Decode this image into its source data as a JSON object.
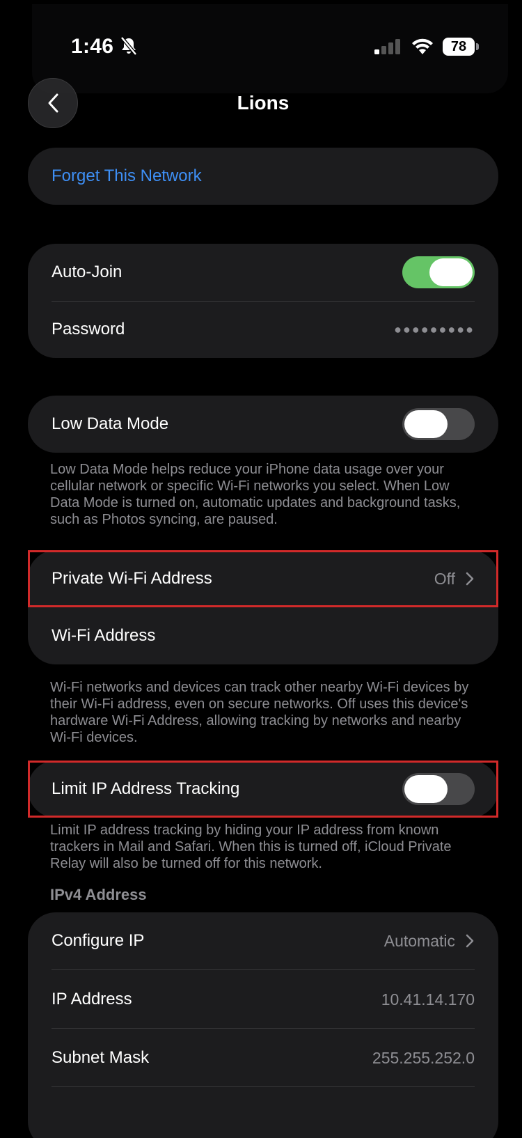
{
  "status_bar": {
    "time": "1:46",
    "battery": "78"
  },
  "nav": {
    "title": "Lions"
  },
  "forget_group": {
    "forget_label": "Forget This Network"
  },
  "join_group": {
    "auto_join_label": "Auto-Join",
    "auto_join_on": true,
    "password_label": "Password",
    "password_mask": "●●●●●●●●●"
  },
  "low_data": {
    "label": "Low Data Mode",
    "on": false,
    "footnote": "Low Data Mode helps reduce your iPhone data usage over your cellular network or specific Wi-Fi networks you select. When Low Data Mode is turned on, automatic updates and background tasks, such as Photos syncing, are paused."
  },
  "private_address": {
    "label": "Private Wi-Fi Address",
    "value": "Off",
    "wifi_address_label": "Wi-Fi Address",
    "footnote": "Wi-Fi networks and devices can track other nearby Wi-Fi devices by their Wi-Fi address, even on secure networks. Off uses this device's hardware Wi-Fi Address, allowing tracking by networks and nearby Wi-Fi devices."
  },
  "limit_ip": {
    "label": "Limit IP Address Tracking",
    "on": false,
    "footnote": "Limit IP address tracking by hiding your IP address from known trackers in Mail and Safari. When this is turned off, iCloud Private Relay will also be turned off for this network."
  },
  "ipv4": {
    "header": "IPv4 Address",
    "configure_label": "Configure IP",
    "configure_value": "Automatic",
    "ip_label": "IP Address",
    "ip_value": "10.41.14.170",
    "subnet_label": "Subnet Mask",
    "subnet_value": "255.255.252.0"
  },
  "colors": {
    "accent": "#3e8ff5",
    "toggle_on": "#65c466",
    "highlight": "#d12a2a"
  }
}
